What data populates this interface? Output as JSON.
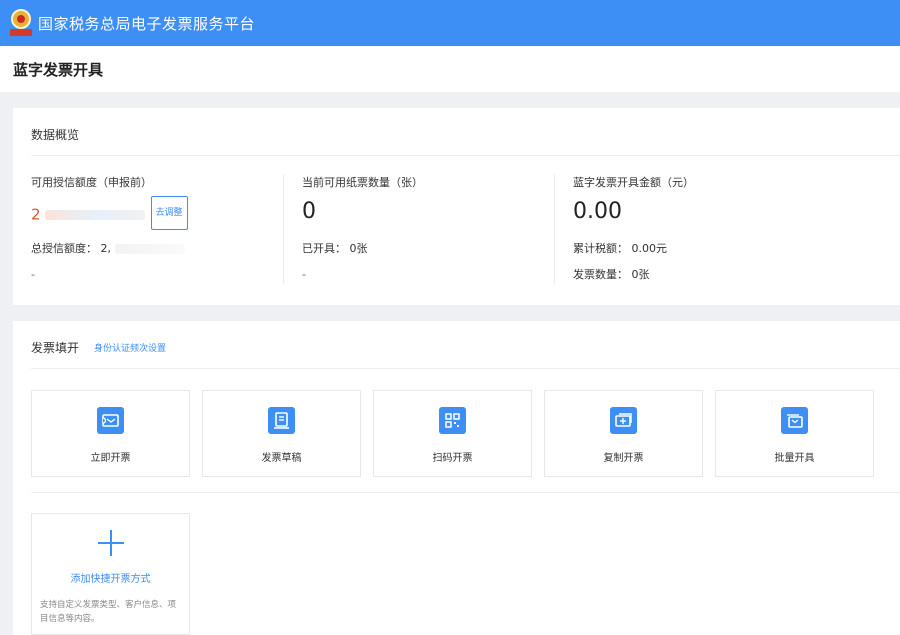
{
  "app": {
    "title": "国家税务总局电子发票服务平台",
    "emblem_caption": "Tax"
  },
  "page": {
    "title": "蓝字发票开具"
  },
  "overview": {
    "title": "数据概览",
    "credit": {
      "label": "可用授信额度（申报前）",
      "value": "2",
      "adjust_label": "去调整",
      "total_label": "总授信额度：",
      "total_value": "2,",
      "dash": "-"
    },
    "paper": {
      "label": "当前可用纸票数量（张）",
      "value": "0",
      "issued_label": "已开具：",
      "issued_value": "0张",
      "dash": "-"
    },
    "amount": {
      "label": "蓝字发票开具金额（元）",
      "value": "0.00",
      "tax_label": "累计税额：",
      "tax_value": "0.00元",
      "count_label": "发票数量：",
      "count_value": "0张"
    }
  },
  "issue": {
    "title": "发票填开",
    "auth_link": "身份认证频次设置",
    "tiles": [
      {
        "label": "立即开票",
        "icon": "ticket-icon"
      },
      {
        "label": "发票草稿",
        "icon": "draft-icon"
      },
      {
        "label": "扫码开票",
        "icon": "qrcode-icon"
      },
      {
        "label": "复制开票",
        "icon": "copy-ticket-icon"
      },
      {
        "label": "批量开具",
        "icon": "batch-icon"
      }
    ],
    "add": {
      "label": "添加快捷开票方式",
      "desc": "支持自定义发票类型、客户信息、项目信息等内容。"
    }
  },
  "colors": {
    "brand": "#3d8ef5",
    "accent_red": "#e2542d"
  }
}
